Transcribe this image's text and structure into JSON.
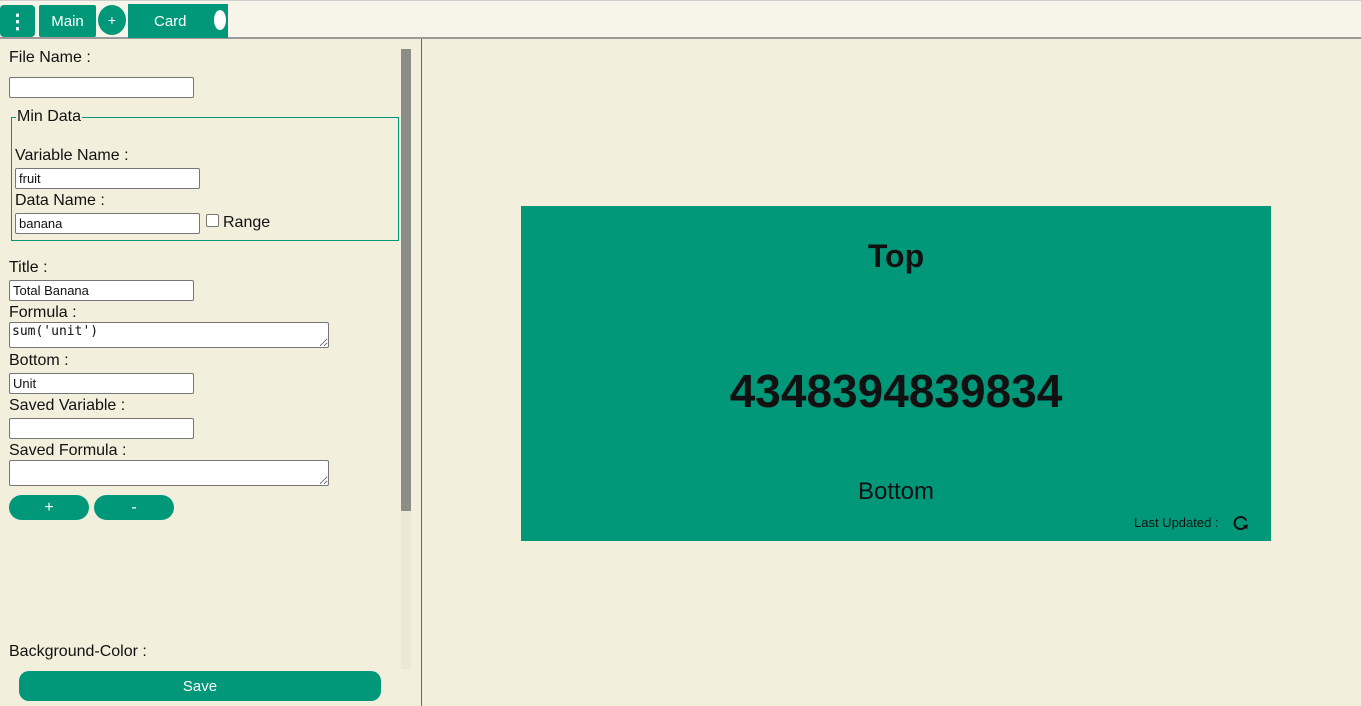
{
  "topbar": {
    "menu_icon": "vertical-dots-icon",
    "menu_glyph": "⋮",
    "main_tab_label": "Main",
    "add_tab_label": "+",
    "card_tab_label": "Card"
  },
  "form": {
    "file_name_label": "File Name :",
    "file_name_value": "",
    "fieldset_legend": "Min Data",
    "variable_name_label": "Variable Name :",
    "variable_name_value": "fruit",
    "data_name_label": "Data Name :",
    "data_name_value": "banana",
    "range_label": "Range",
    "title_label": "Title :",
    "title_value": "Total Banana",
    "formula_label": "Formula :",
    "formula_value": "sum('unit')",
    "bottom_label": "Bottom :",
    "bottom_value": "Unit",
    "saved_variable_label": "Saved Variable :",
    "saved_variable_value": "",
    "saved_formula_label": "Saved Formula :",
    "saved_formula_value": "",
    "add_button_label": "+",
    "remove_button_label": "-",
    "background_color_label": "Background-Color :",
    "save_button_label": "Save"
  },
  "preview": {
    "top_text": "Top",
    "value_text": "4348394839834",
    "bottom_text": "Bottom",
    "last_updated_label": "Last Updated :",
    "refresh_icon": "refresh-icon"
  },
  "colors": {
    "accent": "#009879",
    "background": "#f2efdc",
    "scrollbar_thumb": "#8d8d87"
  }
}
